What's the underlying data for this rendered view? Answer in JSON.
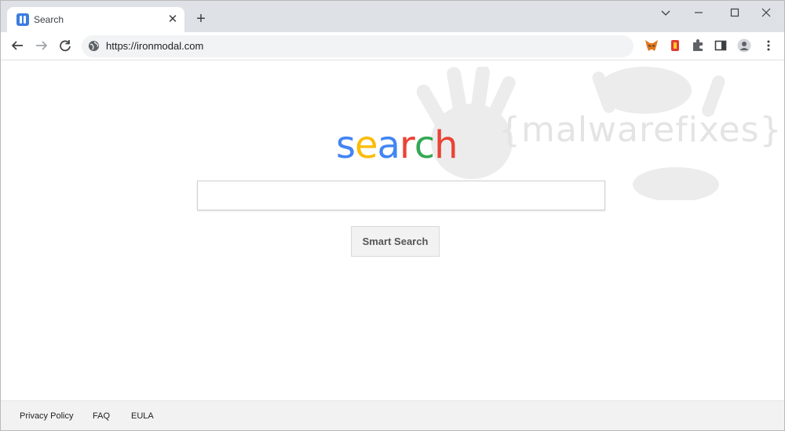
{
  "tab": {
    "title": "Search",
    "close": "✕"
  },
  "newtab": "+",
  "toolbar": {
    "url": "https://ironmodal.com"
  },
  "page": {
    "logo_letters": [
      {
        "ch": "s",
        "color": "#4285f4"
      },
      {
        "ch": "e",
        "color": "#fbbc05"
      },
      {
        "ch": "a",
        "color": "#4285f4"
      },
      {
        "ch": "r",
        "color": "#ea4335"
      },
      {
        "ch": "c",
        "color": "#34a853"
      },
      {
        "ch": "h",
        "color": "#ea4335"
      }
    ],
    "search_value": "",
    "button_label": "Smart Search",
    "watermark": "{malwarefixes}"
  },
  "footer": {
    "privacy": "Privacy Policy",
    "faq": "FAQ",
    "eula": "EULA"
  },
  "colors": {
    "titlebar": "#dee1e6",
    "omnibox": "#f1f3f4",
    "footer": "#f2f2f2"
  }
}
